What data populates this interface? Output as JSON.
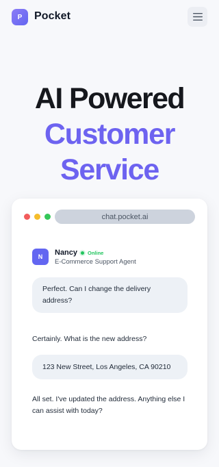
{
  "header": {
    "logo_letter": "P",
    "brand_name": "Pocket",
    "menu_icon": "hamburger-menu-icon"
  },
  "hero": {
    "line1": "AI Powered",
    "line2": "Customer",
    "line3": "Service"
  },
  "chat_window": {
    "url": "chat.pocket.ai",
    "agent": {
      "initial": "N",
      "name": "Nancy",
      "status": "Online",
      "role": "E-Commerce Support Agent"
    },
    "messages": [
      {
        "sender": "user",
        "text": "Perfect. Can I change the delivery address?"
      },
      {
        "sender": "agent",
        "text": "Certainly. What is the new address?"
      },
      {
        "sender": "user",
        "text": "123 New Street, Los Angeles, CA 90210"
      },
      {
        "sender": "agent",
        "text": "All set. I've updated the address. Anything else I can assist with today?"
      }
    ]
  },
  "colors": {
    "accent": "#6366f1",
    "hero_accent": "#6d63f0",
    "online": "#22c55e",
    "bubble": "#edf1f6",
    "background": "#f7f8fb"
  }
}
